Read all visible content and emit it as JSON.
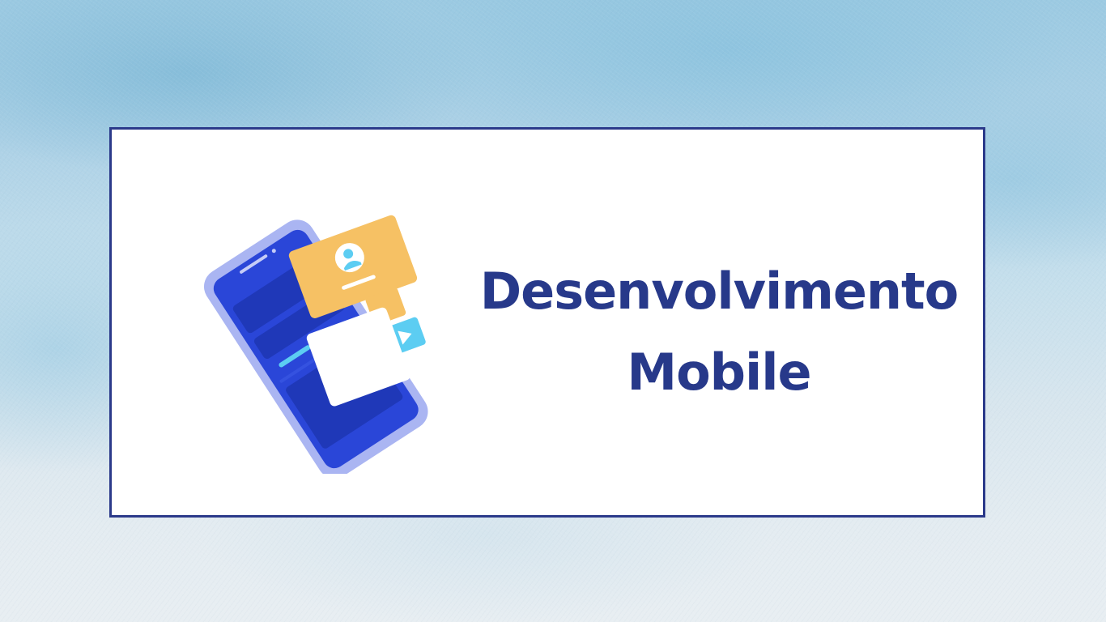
{
  "heading": {
    "line1": "Desenvolvimento",
    "line2": "Mobile"
  },
  "illustration": {
    "icon": "mobile-phone-app-icon"
  },
  "colors": {
    "text": "#27398a",
    "border": "#2b3a8a",
    "phone_body": "#aab5f2",
    "phone_screen": "#2a46d8",
    "card_orange": "#f6c164",
    "accent_cyan": "#5ccdf2"
  }
}
